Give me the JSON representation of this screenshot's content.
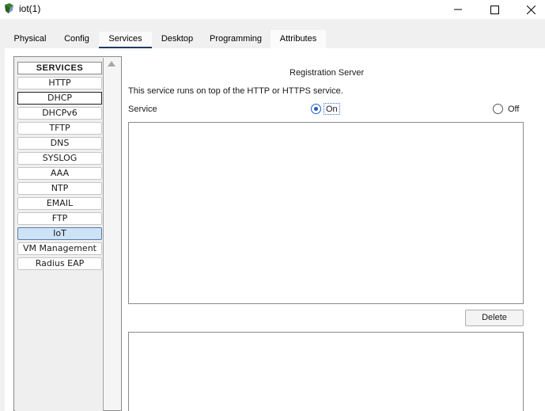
{
  "window": {
    "title": "iot(1)"
  },
  "tabs": [
    {
      "label": "Physical"
    },
    {
      "label": "Config"
    },
    {
      "label": "Services"
    },
    {
      "label": "Desktop"
    },
    {
      "label": "Programming"
    },
    {
      "label": "Attributes"
    }
  ],
  "active_tab": "Services",
  "sidebar": {
    "header": "SERVICES",
    "items": [
      {
        "label": "HTTP"
      },
      {
        "label": "DHCP"
      },
      {
        "label": "DHCPv6"
      },
      {
        "label": "TFTP"
      },
      {
        "label": "DNS"
      },
      {
        "label": "SYSLOG"
      },
      {
        "label": "AAA"
      },
      {
        "label": "NTP"
      },
      {
        "label": "EMAIL"
      },
      {
        "label": "FTP"
      },
      {
        "label": "IoT"
      },
      {
        "label": "VM Management"
      },
      {
        "label": "Radius EAP"
      }
    ],
    "selected": "IoT",
    "focused": "DHCP"
  },
  "panel": {
    "title": "Registration Server",
    "description": "This service runs on top of the HTTP or HTTPS service.",
    "service_label": "Service",
    "on_label": "On",
    "off_label": "Off",
    "service_state": "On",
    "delete_label": "Delete"
  },
  "colors": {
    "accent": "#1f5fbf",
    "active_tab_underline": "#1f3a5f",
    "selected_item_bg": "#cde2f7"
  }
}
